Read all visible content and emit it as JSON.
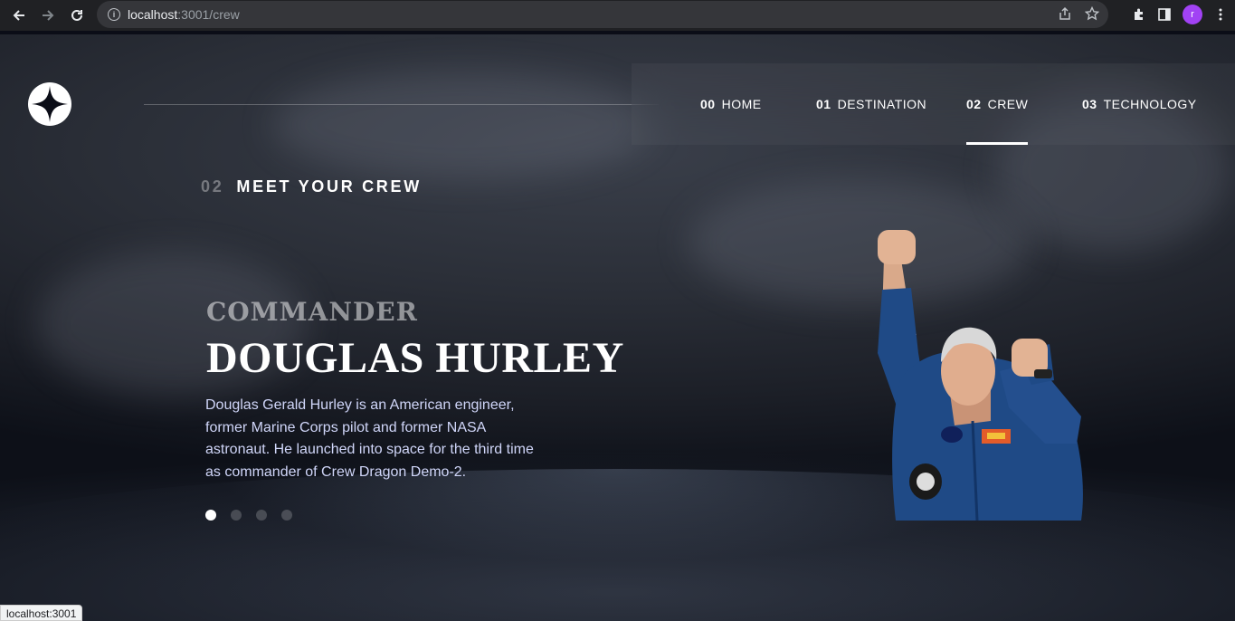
{
  "browser": {
    "url_host": "localhost",
    "url_path": ":3001/crew",
    "avatar_initial": "r",
    "status_text": "localhost:3001"
  },
  "nav": {
    "items": [
      {
        "num": "00",
        "label": "HOME"
      },
      {
        "num": "01",
        "label": "DESTINATION"
      },
      {
        "num": "02",
        "label": "CREW"
      },
      {
        "num": "03",
        "label": "TECHNOLOGY"
      }
    ],
    "active": "CREW"
  },
  "section": {
    "num": "02",
    "title": "MEET YOUR CREW"
  },
  "crew": {
    "role": "COMMANDER",
    "name": "DOUGLAS HURLEY",
    "bio": "Douglas Gerald Hurley is an American engineer, former Marine Corps pilot and former NASA astronaut. He launched into space for the third time as commander of Crew Dragon Demo-2.",
    "slide_count": 4,
    "active_slide": 1
  },
  "colors": {
    "bg": "#0b0d17",
    "text_light": "#d0d6f9",
    "suit_blue": "#1f4a86"
  }
}
